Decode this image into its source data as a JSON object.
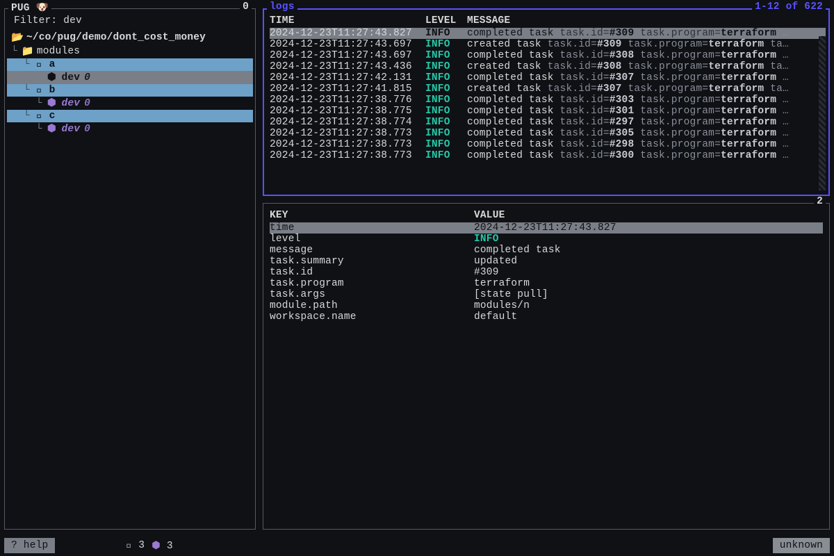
{
  "app": {
    "title": "PUG 🐶",
    "title_right": "0"
  },
  "filter": {
    "label": "Filter:",
    "value": "dev"
  },
  "tree": {
    "root": "~/co/pug/demo/dont_cost_money",
    "modules_label": "modules",
    "folder_icon_open": "📂",
    "folder_icon_closed": "📁",
    "module_icon": "󰠱",
    "ws_icon": "⬢",
    "items": [
      {
        "kind": "module",
        "name": "a",
        "children": [
          {
            "kind": "ws",
            "name": "dev",
            "count": "0",
            "sel": true
          }
        ]
      },
      {
        "kind": "module",
        "name": "b",
        "children": [
          {
            "kind": "ws",
            "name": "dev",
            "count": "0",
            "ital": true
          }
        ]
      },
      {
        "kind": "module",
        "name": "c",
        "children": [
          {
            "kind": "ws",
            "name": "dev",
            "count": "0",
            "ital": true
          }
        ]
      }
    ]
  },
  "logs": {
    "title": "logs",
    "range": "1-12 of 622",
    "headers": {
      "time": "TIME",
      "level": "LEVEL",
      "msg": "MESSAGE"
    },
    "rows": [
      {
        "t": "2024-12-23T11:27:43.827",
        "lvl": "INFO",
        "txt": "completed task",
        "id": "#309",
        "prog": "terraform",
        "tail": "…",
        "sel": true
      },
      {
        "t": "2024-12-23T11:27:43.697",
        "lvl": "INFO",
        "txt": "created task",
        "id": "#309",
        "prog": "terraform",
        "tail": "ta…"
      },
      {
        "t": "2024-12-23T11:27:43.697",
        "lvl": "INFO",
        "txt": "completed task",
        "id": "#308",
        "prog": "terraform",
        "tail": "…"
      },
      {
        "t": "2024-12-23T11:27:43.436",
        "lvl": "INFO",
        "txt": "created task",
        "id": "#308",
        "prog": "terraform",
        "tail": "ta…"
      },
      {
        "t": "2024-12-23T11:27:42.131",
        "lvl": "INFO",
        "txt": "completed task",
        "id": "#307",
        "prog": "terraform",
        "tail": "…"
      },
      {
        "t": "2024-12-23T11:27:41.815",
        "lvl": "INFO",
        "txt": "created task",
        "id": "#307",
        "prog": "terraform",
        "tail": "ta…"
      },
      {
        "t": "2024-12-23T11:27:38.776",
        "lvl": "INFO",
        "txt": "completed task",
        "id": "#303",
        "prog": "terraform",
        "tail": "…"
      },
      {
        "t": "2024-12-23T11:27:38.775",
        "lvl": "INFO",
        "txt": "completed task",
        "id": "#301",
        "prog": "terraform",
        "tail": "…"
      },
      {
        "t": "2024-12-23T11:27:38.774",
        "lvl": "INFO",
        "txt": "completed task",
        "id": "#297",
        "prog": "terraform",
        "tail": "…"
      },
      {
        "t": "2024-12-23T11:27:38.773",
        "lvl": "INFO",
        "txt": "completed task",
        "id": "#305",
        "prog": "terraform",
        "tail": "…"
      },
      {
        "t": "2024-12-23T11:27:38.773",
        "lvl": "INFO",
        "txt": "completed task",
        "id": "#298",
        "prog": "terraform",
        "tail": "…"
      },
      {
        "t": "2024-12-23T11:27:38.773",
        "lvl": "INFO",
        "txt": "completed task",
        "id": "#300",
        "prog": "terraform",
        "tail": "…"
      }
    ],
    "label_task_id": "task.id=",
    "label_task_prog": "task.program="
  },
  "details": {
    "title_right": "2",
    "headers": {
      "key": "KEY",
      "val": "VALUE"
    },
    "rows": [
      {
        "k": "time",
        "v": "2024-12-23T11:27:43.827",
        "sel": true
      },
      {
        "k": "level",
        "v": "INFO",
        "cls": "info"
      },
      {
        "k": "message",
        "v": "completed task"
      },
      {
        "k": "task.summary",
        "v": "updated"
      },
      {
        "k": "task.id",
        "v": "#309"
      },
      {
        "k": "task.program",
        "v": "terraform"
      },
      {
        "k": "task.args",
        "v": "[state pull]"
      },
      {
        "k": "module.path",
        "v": "modules/n"
      },
      {
        "k": "workspace.name",
        "v": "default"
      }
    ]
  },
  "footer": {
    "help": "? help",
    "mod_icon": "󰠱",
    "mod_count": "3",
    "ws_icon": "⬢",
    "ws_count": "3",
    "status": "unknown"
  }
}
